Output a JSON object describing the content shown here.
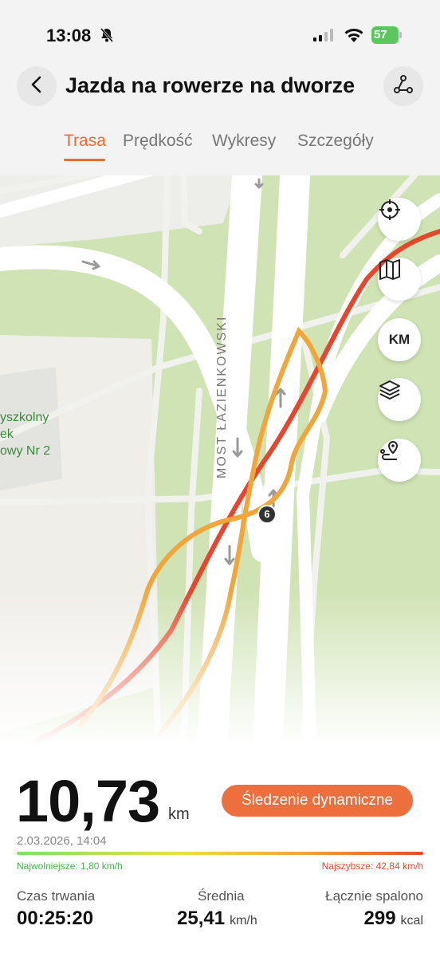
{
  "status_bar": {
    "time": "13:08",
    "battery": "57",
    "icons": [
      "bell-muted-icon",
      "signal-icon",
      "wifi-icon",
      "battery-charging-icon"
    ]
  },
  "header": {
    "title": "Jazda na rowerze na dworze",
    "back_icon": "chevron-left-icon",
    "route_icon": "route-nodes-icon"
  },
  "tabs": [
    {
      "label": "Trasa",
      "active": true
    },
    {
      "label": "Prędkość",
      "active": false
    },
    {
      "label": "Wykresy",
      "active": false
    },
    {
      "label": "Szczegóły",
      "active": false
    }
  ],
  "map": {
    "bridge_label": "MOST ŁAZIENKOWSKI",
    "place_label": "yszkolny\nek\nowy Nr 2",
    "marker_label": "6",
    "tools": [
      {
        "icon": "locate-icon",
        "label": ""
      },
      {
        "icon": "map-icon",
        "label": ""
      },
      {
        "icon": "units-icon",
        "label": "KM"
      },
      {
        "icon": "layers-icon",
        "label": ""
      },
      {
        "icon": "route-pin-icon",
        "label": ""
      }
    ],
    "colors": {
      "grass": "#cfe3b4",
      "road": "#ffffff",
      "route_fast": "#e9452c",
      "route_slow": "#f2a63a"
    }
  },
  "stats": {
    "distance": "10,73",
    "distance_unit": "km",
    "dynamic_button": "Śledzenie dynamiczne",
    "date": "2.03.2026, 14:04",
    "slowest": "Najwolniejsze: 1,80 km/h",
    "fastest": "Najszybsze: 42,84 km/h",
    "duration_label": "Czas trwania",
    "duration_value": "00:25:20",
    "average_label": "Średnia",
    "average_value": "25,41",
    "average_unit": "km/h",
    "calories_label": "Łącznie spalono",
    "calories_value": "299",
    "calories_unit": "kcal"
  }
}
